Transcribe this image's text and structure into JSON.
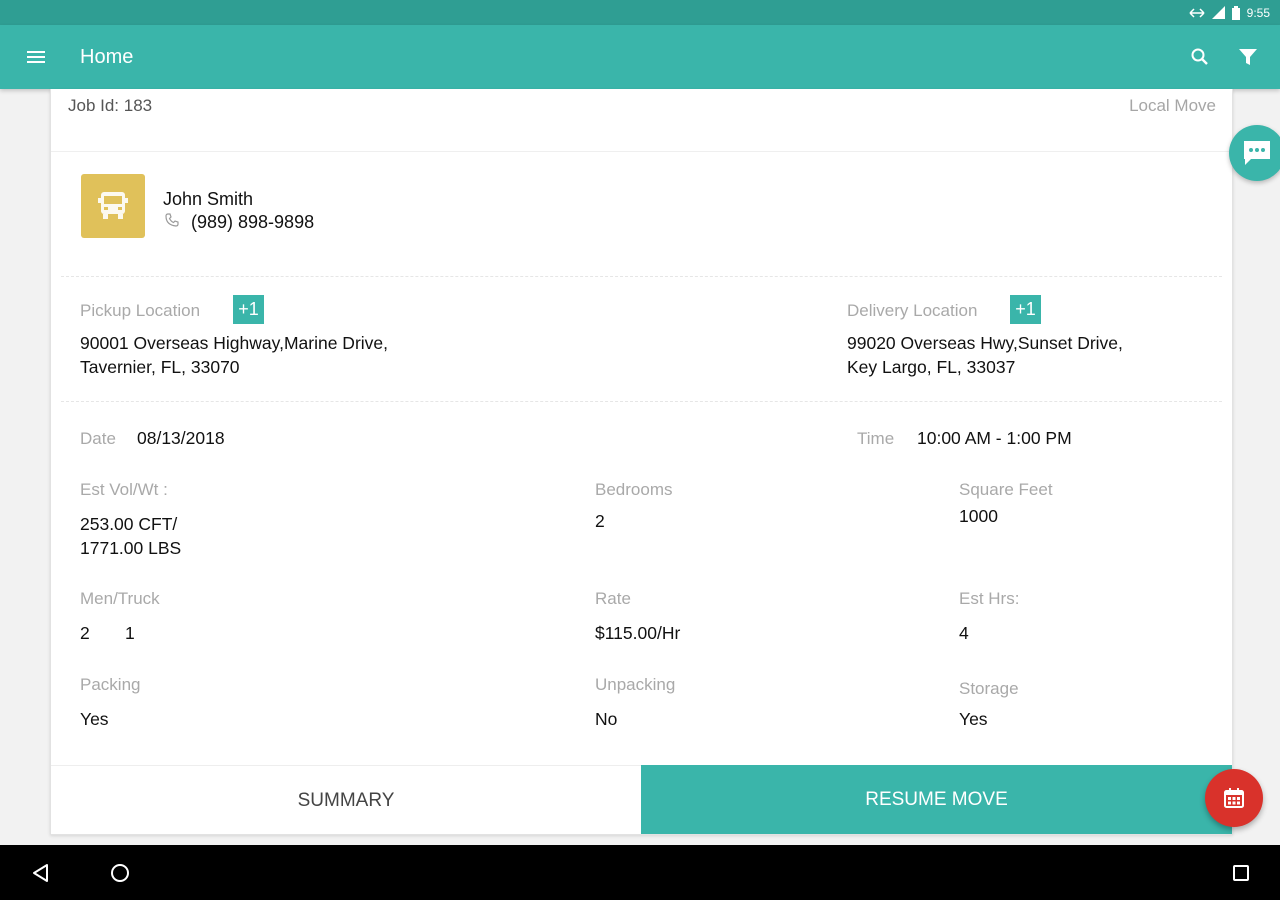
{
  "status_bar": {
    "time": "9:55"
  },
  "app_bar": {
    "title": "Home"
  },
  "job": {
    "id_text": "Job Id: 183",
    "move_type": "Local Move",
    "customer": {
      "name": "John Smith",
      "phone": "(989) 898-9898"
    },
    "pickup": {
      "label": "Pickup Location",
      "badge": "+1",
      "address_line1": "90001 Overseas Highway,Marine Drive,",
      "address_line2": "Tavernier, FL, 33070"
    },
    "delivery": {
      "label": "Delivery Location",
      "badge": "+1",
      "address_line1": "99020 Overseas Hwy,Sunset Drive,",
      "address_line2": "Key Largo, FL, 33037"
    },
    "date": {
      "label": "Date",
      "value": "08/13/2018"
    },
    "time": {
      "label": "Time",
      "value": "10:00 AM - 1:00 PM"
    },
    "est_vol": {
      "label": "Est Vol/Wt :",
      "value_line1": "253.00 CFT/",
      "value_line2": "1771.00 LBS"
    },
    "bedrooms": {
      "label": "Bedrooms",
      "value": "2"
    },
    "square_feet": {
      "label": "Square Feet",
      "value": "1000"
    },
    "men_truck": {
      "label": "Men/Truck",
      "men": "2",
      "truck": "1"
    },
    "rate": {
      "label": "Rate",
      "value": "$115.00/Hr"
    },
    "est_hrs": {
      "label": "Est Hrs:",
      "value": "4"
    },
    "packing": {
      "label": "Packing",
      "value": "Yes"
    },
    "unpacking": {
      "label": "Unpacking",
      "value": "No"
    },
    "storage": {
      "label": "Storage",
      "value": "Yes"
    }
  },
  "actions": {
    "summary": "SUMMARY",
    "resume": "RESUME MOVE"
  },
  "colors": {
    "status_bar": "#2f9e93",
    "primary": "#3ab5aa",
    "truck_tile": "#e0c15a",
    "calendar_fab": "#d9322b"
  },
  "icons": {
    "menu": "menu-icon",
    "search": "search-icon",
    "filter": "filter-icon",
    "truck": "truck-icon",
    "phone": "phone-icon",
    "chat": "chat-icon",
    "calendar": "calendar-icon"
  }
}
